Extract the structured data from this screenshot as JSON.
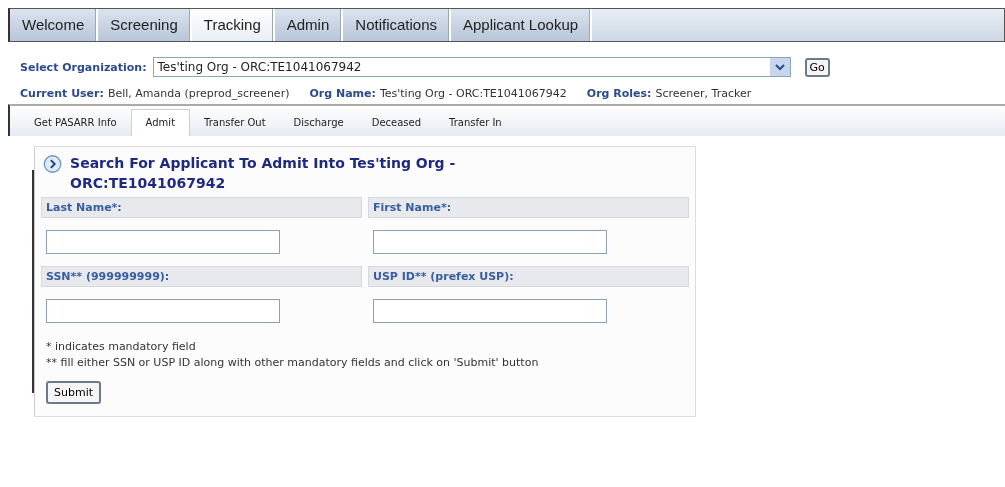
{
  "tabs": [
    {
      "label": "Welcome",
      "selected": false
    },
    {
      "label": "Screening",
      "selected": false
    },
    {
      "label": "Tracking",
      "selected": true
    },
    {
      "label": "Admin",
      "selected": false
    },
    {
      "label": "Notifications",
      "selected": false
    },
    {
      "label": "Applicant Lookup",
      "selected": false
    }
  ],
  "organization": {
    "label": "Select Organization:",
    "value": "Tes'ting Org - ORC:TE1041067942",
    "go": "Go"
  },
  "info": [
    {
      "label": "Current User:",
      "value": "Bell, Amanda (preprod_screener)"
    },
    {
      "label": "Org Name:",
      "value": "Tes'ting Org - ORC:TE1041067942"
    },
    {
      "label": "Org Roles:",
      "value": "Screener, Tracker"
    }
  ],
  "subtabs": [
    {
      "label": "Get PASARR Info",
      "selected": false
    },
    {
      "label": "Admit",
      "selected": true
    },
    {
      "label": "Transfer Out",
      "selected": false
    },
    {
      "label": "Discharge",
      "selected": false
    },
    {
      "label": "Deceased",
      "selected": false
    },
    {
      "label": "Transfer In",
      "selected": false
    }
  ],
  "form": {
    "title": "Search For Applicant To Admit Into Tes'ting Org - ORC:TE1041067942",
    "fields": [
      {
        "label": "Last Name*:"
      },
      {
        "label": "First Name*:"
      },
      {
        "label": "SSN** (999999999):"
      },
      {
        "label": "USP ID** (prefex USP):"
      }
    ],
    "notes": [
      "*  indicates mandatory field",
      "** fill either SSN or USP ID along with other mandatory fields and click on 'Submit' button"
    ],
    "submit": "Submit"
  }
}
